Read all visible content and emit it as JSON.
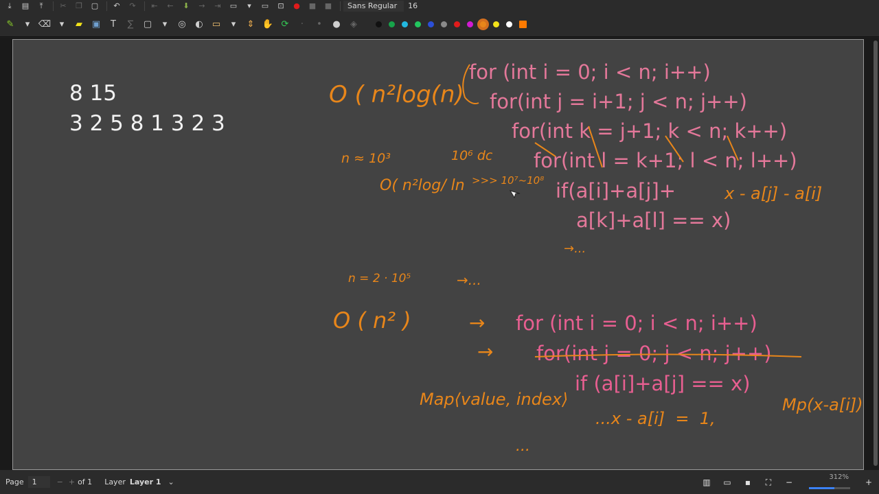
{
  "toolbar_top": {
    "font_name": "Sans Regular",
    "font_size": "16",
    "buttons": [
      "save-icon",
      "new-page-icon",
      "export-icon",
      "cut-icon",
      "copy-icon",
      "paste-icon",
      "undo-icon",
      "redo-icon",
      "back-icon",
      "prev-icon",
      "down-icon",
      "next-icon",
      "forward-icon",
      "new-page-icon",
      "pdf-icon",
      "record-icon",
      "stop-icon",
      "pause-icon"
    ]
  },
  "toolbar_tools": {
    "colors": [
      "#111111",
      "#17a34a",
      "#22b8e0",
      "#22c55e",
      "#2b4fd8",
      "#8a8a8a",
      "#e01b1b",
      "#d11ad1",
      "#e8861a",
      "#f2e21a",
      "#ffffff",
      "#ff7a00"
    ]
  },
  "page": {
    "white_lines": [
      "8 15",
      "3 2 5 8 1 3 2 3"
    ],
    "code_pink": [
      "for (int i = 0; i < n; i++)",
      "for(int j = i+1; j < n; j++)",
      "for(int k = j+1; k < n; k++)",
      "for(int l = k+1; l < n; l++)",
      "if(a[i]+a[j]+",
      "a[k]+a[l] == x)"
    ],
    "code_pink2": [
      "for (int i = 0; i < n; i++)",
      "for(int j = 0; j < n; j++)",
      "if (a[i]+a[j] == x)"
    ],
    "handwriting": {
      "complexity1": "O ( n²log(n)",
      "n_approx": "n ≈ 10³",
      "ops": "10⁶ dc",
      "cmp": ">>> 10⁷~10⁸",
      "complexity2": "O( n²log/ ln",
      "x_expr": "x - a[j] - a[i]",
      "dots1": "→...",
      "n_val": "n = 2 · 10⁵",
      "dots2": "→...",
      "complexity3": "O ( n² )",
      "arrow1": "→",
      "arrow2": "→",
      "map": "Map⟨value, index⟩",
      "line_bottom": "...x - a[i]  =  1,",
      "mp": "Mp(x-a[i])",
      "dots3": "..."
    }
  },
  "status": {
    "page_label": "Page",
    "page_value": "1",
    "of_label": "of 1",
    "layer_label": "Layer",
    "layer_value": "Layer 1",
    "zoom": "312%",
    "zoom_fraction": 0.62
  }
}
